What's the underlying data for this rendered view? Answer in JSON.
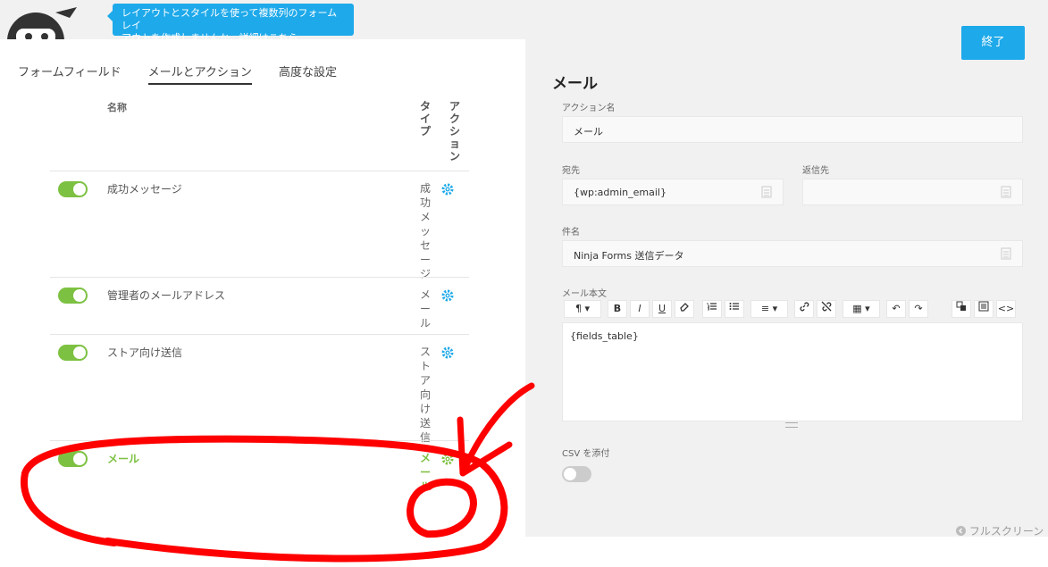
{
  "tooltip": {
    "line1": "レイアウトとスタイルを使って複数列のフォームレイ",
    "line2": "アウトを作成しませんか。詳細はこちら"
  },
  "tabs": [
    {
      "label": "フォームフィールド"
    },
    {
      "label": "メールとアクション"
    },
    {
      "label": "高度な設定"
    }
  ],
  "table": {
    "col_name": "名称",
    "col_type": "タイプ",
    "col_action": "アクション",
    "rows": [
      {
        "name": "成功メッセージ",
        "type": "成功メッセージ"
      },
      {
        "name": "管理者のメールアドレス",
        "type": "メール"
      },
      {
        "name": "ストア向け送信",
        "type": "ストア向け送信"
      },
      {
        "name": "メール",
        "type": "メール"
      }
    ]
  },
  "panel": {
    "done_label": "終了",
    "title": "メール",
    "action_name_label": "アクション名",
    "action_name_value": "メール",
    "to_label": "宛先",
    "to_value": "{wp:admin_email}",
    "reply_label": "返信先",
    "reply_value": "",
    "subject_label": "件名",
    "subject_value": "Ninja Forms 送信データ",
    "body_label": "メール本文",
    "body_value": "{fields_table}",
    "csv_label": "CSV を添付",
    "fullscreen_label": "フルスクリーン"
  },
  "toolbar": {
    "paragraph": "¶ ▾",
    "bold": "B",
    "italic": "I",
    "underline": "U",
    "align": "≡ ▾",
    "table": "▦ ▾",
    "undo": "↶",
    "redo": "↷",
    "code": "<>"
  },
  "colors": {
    "accent": "#1ea9ea",
    "active_green": "#7dc142",
    "annotation_red": "#ff0000"
  },
  "icons": [
    "ninja-logo-icon",
    "gear-icon",
    "merge-tag-icon",
    "fullscreen-icon"
  ]
}
